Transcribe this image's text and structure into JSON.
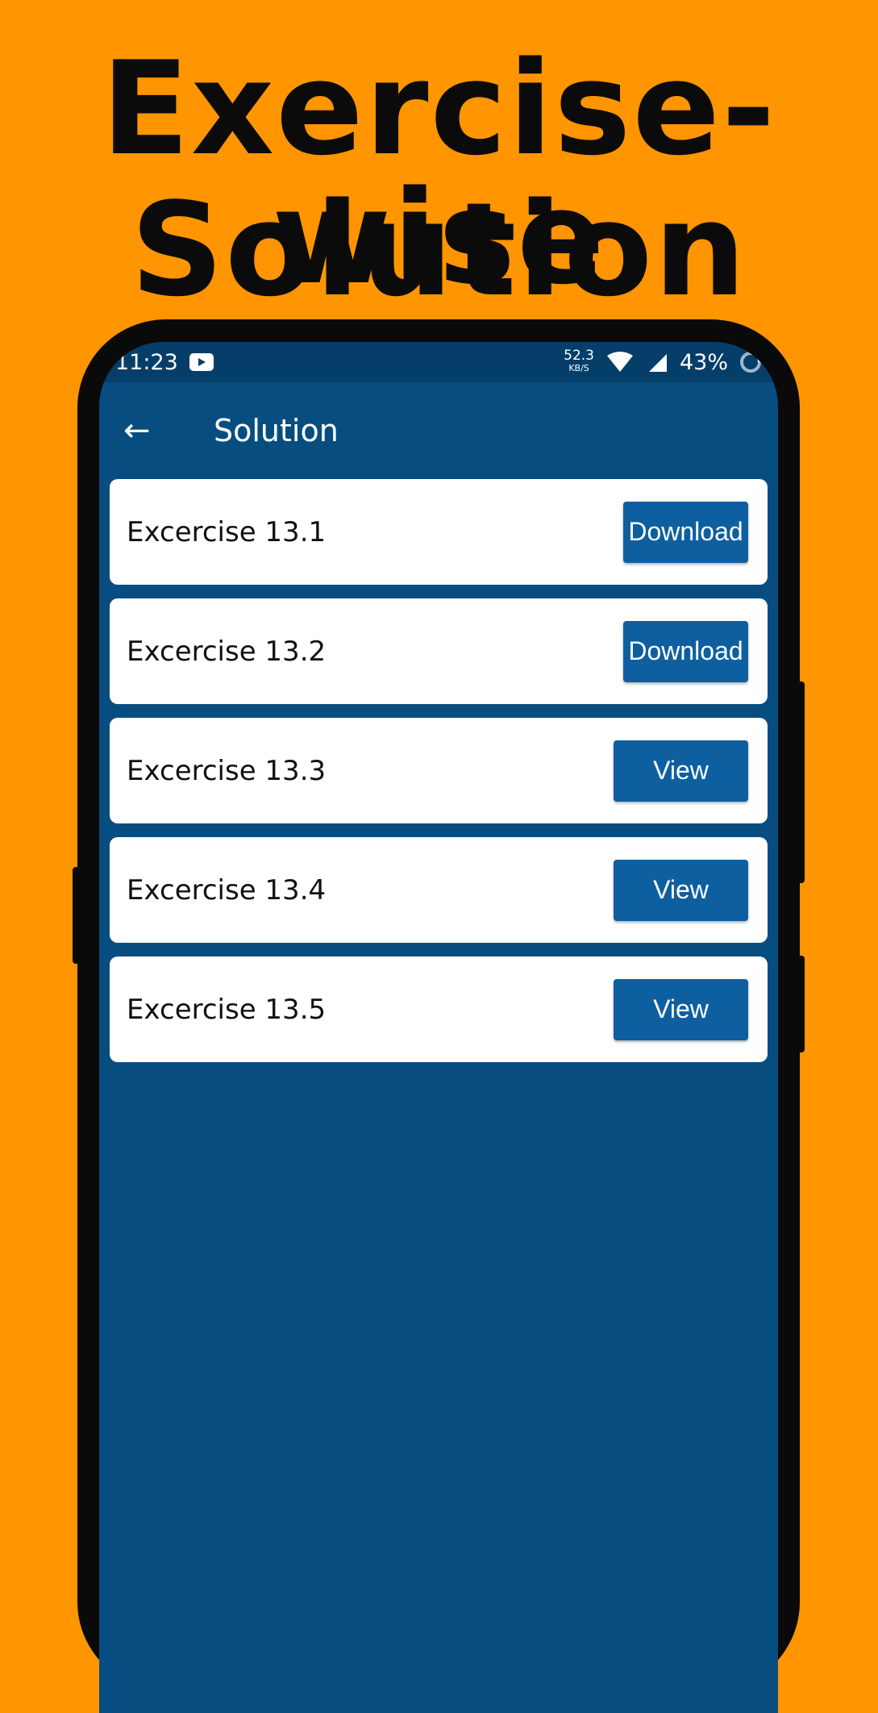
{
  "headline": {
    "line1": "Exercise-wise",
    "line2": "Solution"
  },
  "status_bar": {
    "time": "11:23",
    "net_speed": "52.3",
    "net_unit": "KB/S",
    "battery": "43%"
  },
  "app_bar": {
    "title": "Solution",
    "back_icon": "arrow-left-icon"
  },
  "colors": {
    "background": "#FF9500",
    "app": "#084D80",
    "button": "#0E5FA0"
  },
  "exercises": [
    {
      "label": "Excercise 13.1",
      "action": "Download"
    },
    {
      "label": "Excercise 13.2",
      "action": "Download"
    },
    {
      "label": "Excercise 13.3",
      "action": "View"
    },
    {
      "label": "Excercise 13.4",
      "action": "View"
    },
    {
      "label": "Excercise 13.5",
      "action": "View"
    }
  ]
}
